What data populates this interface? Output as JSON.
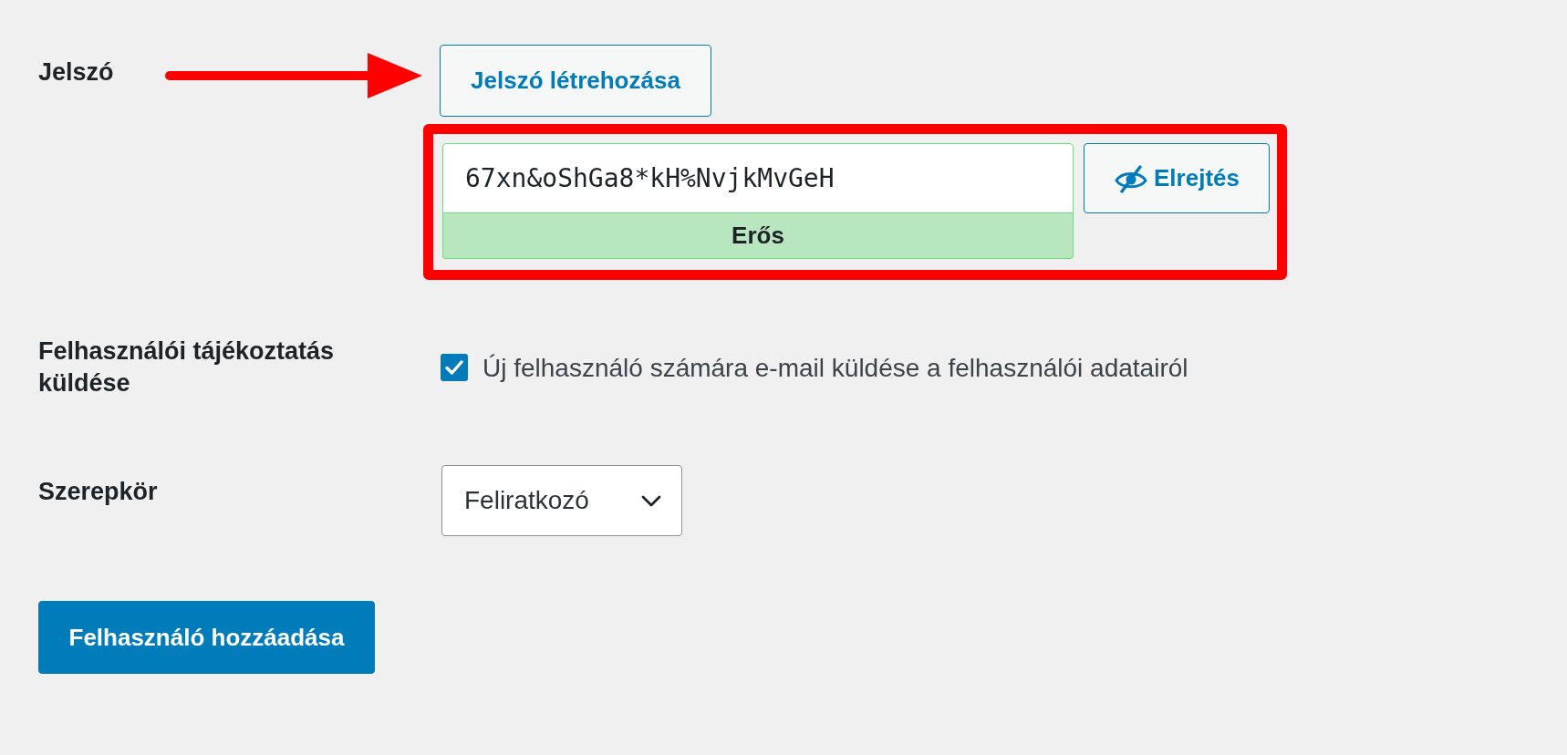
{
  "password": {
    "label": "Jelszó",
    "generate_button": "Jelszó létrehozása",
    "value": "67xn&oShGa8*kH%NvjkMvGeH",
    "strength_meter": {
      "label": "Erős",
      "kind": "strong"
    },
    "hide_button": "Elrejtés"
  },
  "notify": {
    "label": "Felhasználói tájékoztatás küldése",
    "checked": true,
    "text": "Új felhasználó számára e-mail küldése a felhasználói adatairól"
  },
  "role": {
    "label": "Szerepkör",
    "value": "Feliratkozó"
  },
  "submit_button": "Felhasználó hozzáadása"
}
